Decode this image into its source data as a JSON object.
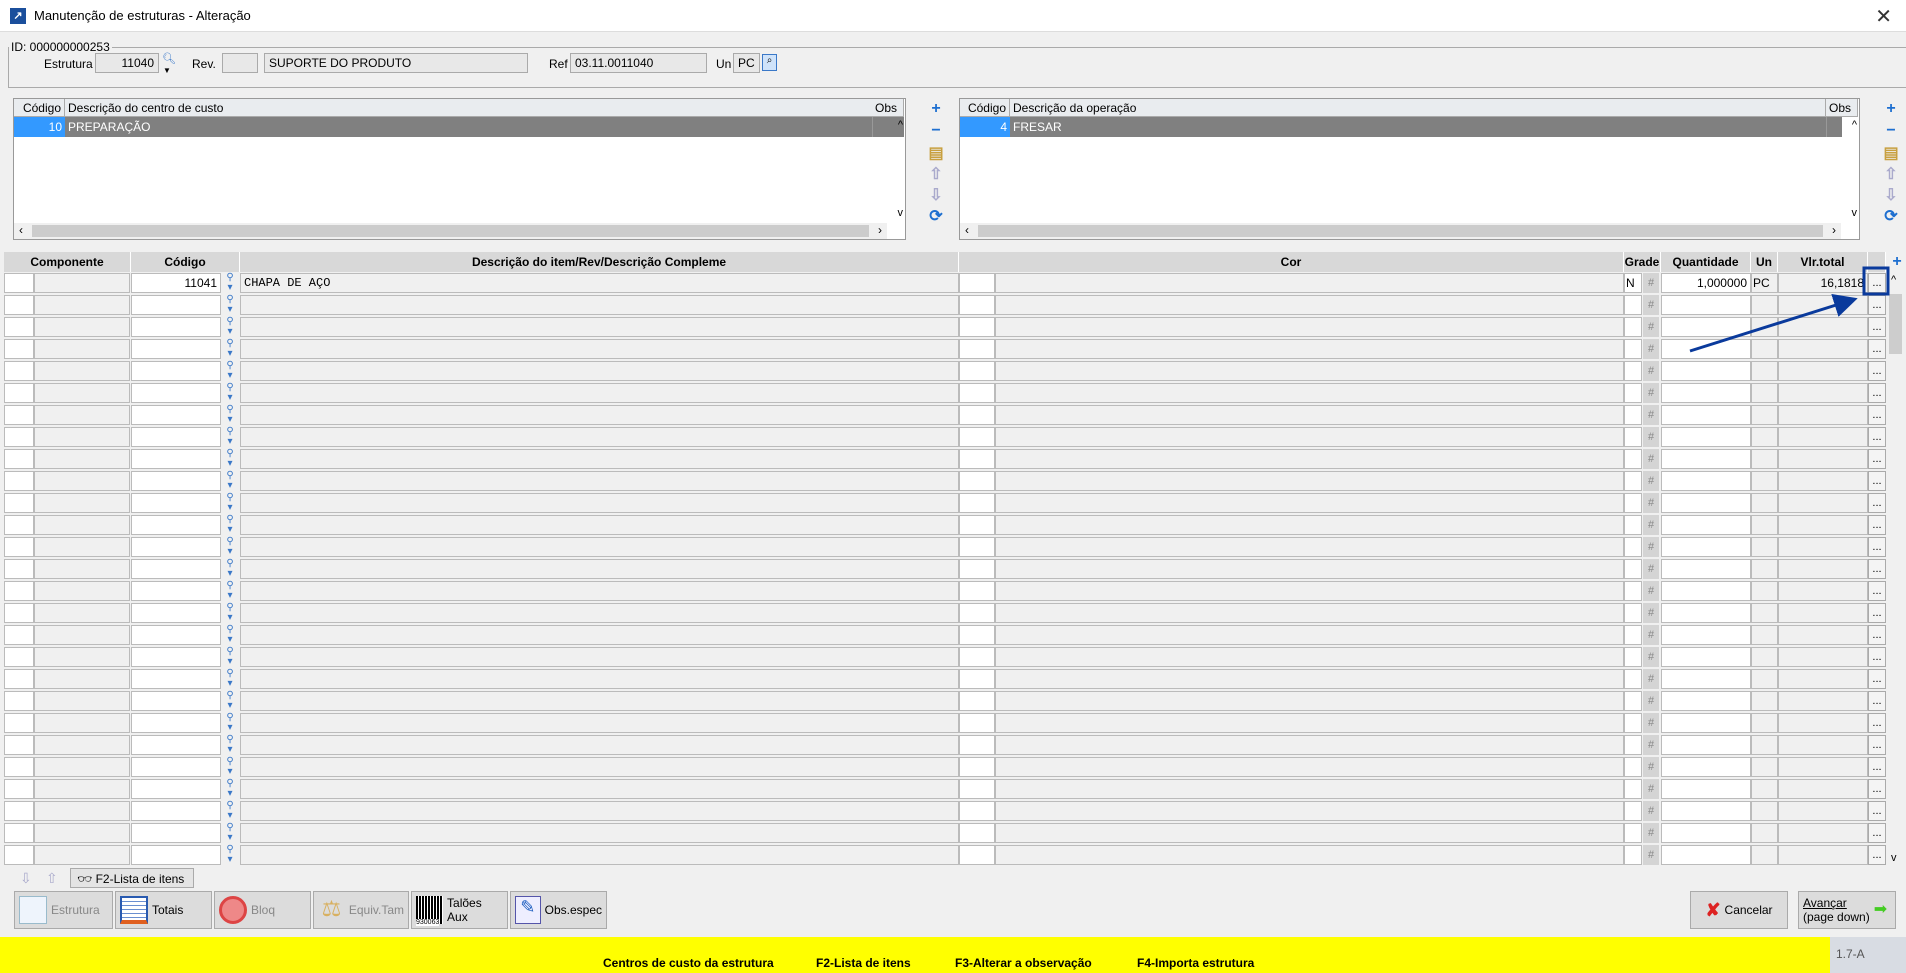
{
  "window": {
    "title": "Manutenção de estruturas - Alteração",
    "close": "✕"
  },
  "header": {
    "group_label": "ID: 000000000253",
    "estrutura_label": "Estrutura",
    "estrutura_value": "11040",
    "rev_label": "Rev.",
    "rev_value": "",
    "descricao_value": "SUPORTE DO PRODUTO",
    "ref_label": "Ref",
    "ref_value": "03.11.0011040",
    "un_label": "Un",
    "un_value": "PC"
  },
  "cost_center_grid": {
    "columns": [
      "Código",
      "Descrição do centro de custo",
      "Obs"
    ],
    "rows": [
      {
        "codigo": "10",
        "descricao": "PREPARAÇÃO",
        "obs": ""
      }
    ]
  },
  "operation_grid": {
    "columns": [
      "Código",
      "Descrição da operação",
      "Obs"
    ],
    "rows": [
      {
        "codigo": "4",
        "descricao": "FRESAR",
        "obs": ""
      }
    ]
  },
  "items_grid": {
    "columns": [
      "Componente",
      "Código",
      "Descrição do item/Rev/Descrição Compleme",
      "Cor",
      "Grade",
      "Quantidade",
      "Un",
      "Vlr.total"
    ],
    "rows": [
      {
        "componente": "",
        "codigo": "11041",
        "descricao": "CHAPA DE AÇO",
        "cor": "",
        "grade": "N",
        "quantidade": "1,000000",
        "un": "PC",
        "vlr_total": "16,1818"
      }
    ],
    "dots_label": "...",
    "hash_label": "#"
  },
  "bottom": {
    "lista_button": "F2-Lista de itens"
  },
  "toolbar": [
    {
      "label": "Estrutura",
      "enabled": true
    },
    {
      "label": "Totais",
      "enabled": true
    },
    {
      "label": "Bloq",
      "enabled": false
    },
    {
      "label": "Equiv.Tam",
      "enabled": false
    },
    {
      "label": "Talões Aux",
      "enabled": true
    },
    {
      "label": "Obs.espec",
      "enabled": true
    }
  ],
  "barcode_text": "930063",
  "actions": {
    "cancel": "Cancelar",
    "next_line1": "Avançar",
    "next_line2": "(page down)"
  },
  "status_bar": {
    "items": [
      "Centros de custo da estrutura",
      "F2-Lista de itens",
      "F3-Alterar a observação",
      "F4-Importa estrutura"
    ],
    "version": "1.7-A"
  },
  "colors": {
    "selection": "#3399ff",
    "row_selected": "#808080",
    "status_bar": "#ffff00",
    "annotation": "#0a3a9c"
  }
}
